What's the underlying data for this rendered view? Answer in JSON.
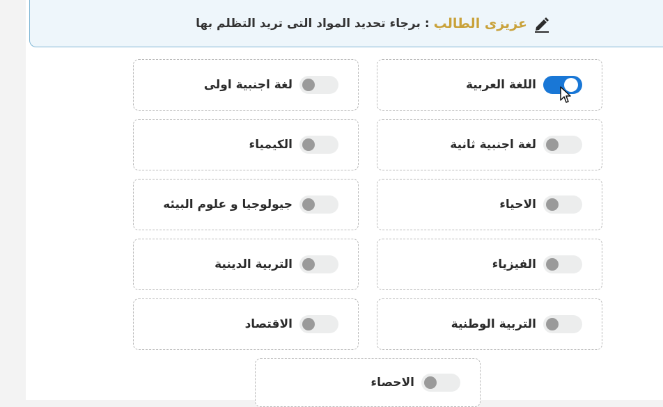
{
  "notice": {
    "greeting": "عزيزى الطالب",
    "separator": ":",
    "message": "برجاء تحديد المواد التى تريد التظلم بها",
    "icon": "pencil-icon"
  },
  "subjects": [
    {
      "label": "اللغة العربية",
      "selected": true
    },
    {
      "label": "لغة اجنبية اولى",
      "selected": false
    },
    {
      "label": "لغة اجنبية ثانية",
      "selected": false
    },
    {
      "label": "الكيمياء",
      "selected": false
    },
    {
      "label": "الاحياء",
      "selected": false
    },
    {
      "label": "جيولوجيا و علوم البيئه",
      "selected": false
    },
    {
      "label": "الفيزياء",
      "selected": false
    },
    {
      "label": "التربية الدينية",
      "selected": false
    },
    {
      "label": "التربية الوطنية",
      "selected": false
    },
    {
      "label": "الاقتصاد",
      "selected": false
    },
    {
      "label": "الاحصاء",
      "selected": false
    }
  ],
  "colors": {
    "accent": "#1977d6",
    "highlight": "#c9a23a",
    "notice_bg": "#eef6fb",
    "notice_border": "#7fb6d4"
  }
}
